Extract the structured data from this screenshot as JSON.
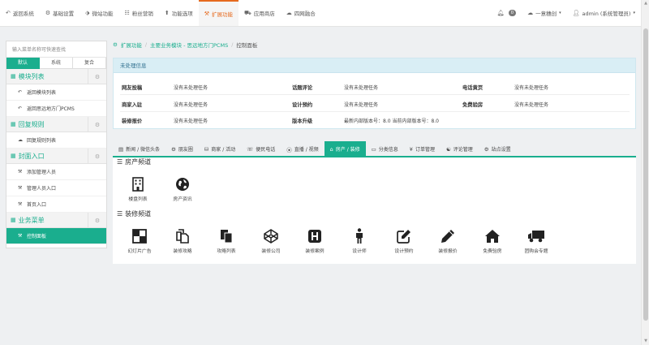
{
  "topnav": {
    "items": [
      {
        "icon": "↶",
        "label": "返回系统"
      },
      {
        "icon": "⚙",
        "label": "基础设置"
      },
      {
        "icon": "⬗",
        "label": "微站功能"
      },
      {
        "icon": "☷",
        "label": "粉丝营销"
      },
      {
        "icon": "⬆",
        "label": "功能选项"
      },
      {
        "icon": "⚒",
        "label": "扩展功能"
      },
      {
        "icon": "⛟",
        "label": "应用商店"
      },
      {
        "icon": "☁",
        "label": "四网融合"
      }
    ],
    "active_index": 5,
    "notif_count": "0",
    "user_link": "一意穗创",
    "admin": "admin (系统管理员)"
  },
  "sidebar": {
    "search_placeholder": "输入菜单名称可快速查找",
    "tabs": [
      "默认",
      "系统",
      "复合"
    ],
    "groups": [
      {
        "title": "模块列表",
        "items": [
          "返回模块列表",
          "返回思远地方门PCMS"
        ]
      },
      {
        "title": "回复规则",
        "items": [
          "回复规则列表"
        ]
      },
      {
        "title": "封面入口",
        "items": [
          "添加管理人员",
          "管理人员入口",
          "首页入口"
        ]
      },
      {
        "title": "业务菜单",
        "items": [
          "控制面板"
        ]
      }
    ]
  },
  "breadcrumb": [
    "扩展功能",
    "主要业务模块 - 思远地方门PCMS",
    "控制面板"
  ],
  "panel": {
    "header": "未处理信息",
    "rows": [
      [
        {
          "label": "网友投稿",
          "value": "没有未处理任务"
        },
        {
          "label": "话题评论",
          "value": "没有未处理任务"
        },
        {
          "label": "电话黄页",
          "value": "没有未处理任务"
        }
      ],
      [
        {
          "label": "商家入驻",
          "value": "没有未处理任务"
        },
        {
          "label": "设计预约",
          "value": "没有未处理任务"
        },
        {
          "label": "免费验房",
          "value": "没有未处理任务"
        }
      ],
      [
        {
          "label": "装修报价",
          "value": "没有未处理任务"
        },
        {
          "label": "版本升级",
          "value": "最新内部版本号：8.0   当前内部版本号：8.0"
        }
      ]
    ]
  },
  "tabs": [
    {
      "icon": "▤",
      "label": "新闻 / 微信头条"
    },
    {
      "icon": "⚙",
      "label": "朋友圈"
    },
    {
      "icon": "⛁",
      "label": "商家 / 活动"
    },
    {
      "icon": "☏",
      "label": "便民电话"
    },
    {
      "icon": "⦿",
      "label": "直播 / 视频"
    },
    {
      "icon": "⌂",
      "label": "房产 / 装修"
    },
    {
      "icon": "▭",
      "label": "分类信息"
    },
    {
      "icon": "¥",
      "label": "订单管理"
    },
    {
      "icon": "☯",
      "label": "评论管理"
    },
    {
      "icon": "⚙",
      "label": "站点设置"
    }
  ],
  "active_tab": 5,
  "sections": [
    {
      "title": "房产频道",
      "tiles": [
        {
          "icon": "building-icon",
          "label": "楼盘列表"
        },
        {
          "icon": "globe-icon",
          "label": "房产资讯"
        }
      ]
    },
    {
      "title": "装修频道",
      "tiles": [
        {
          "icon": "adjust-icon",
          "label": "幻灯片广告"
        },
        {
          "icon": "copy-icon",
          "label": "装修攻略"
        },
        {
          "icon": "documents-icon",
          "label": "攻略列表"
        },
        {
          "icon": "codepen-icon",
          "label": "装修公司"
        },
        {
          "icon": "h-square-icon",
          "label": "装修案例"
        },
        {
          "icon": "person-icon",
          "label": "设计师"
        },
        {
          "icon": "edit-icon",
          "label": "设计预约"
        },
        {
          "icon": "pencil-icon",
          "label": "装修报价"
        },
        {
          "icon": "home-icon",
          "label": "免费验房"
        },
        {
          "icon": "truck-icon",
          "label": "团购会专题"
        }
      ]
    }
  ],
  "colors": {
    "accent": "#1aae8e",
    "nav_active": "#e66a1f",
    "info_bg": "#d9eef5"
  }
}
